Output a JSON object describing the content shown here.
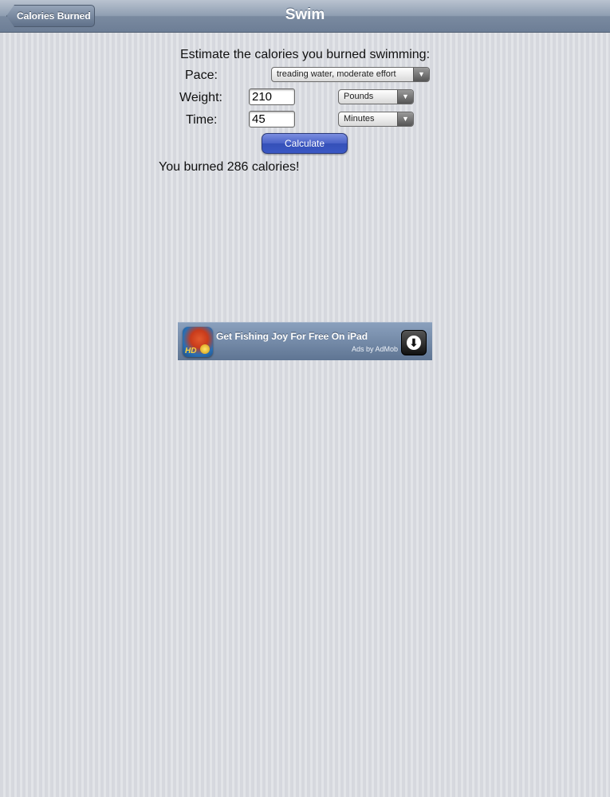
{
  "navbar": {
    "back_label": "Calories Burned",
    "title": "Swim"
  },
  "form": {
    "heading": "Estimate the calories you burned swimming:",
    "pace": {
      "label": "Pace:",
      "selected": "treading water, moderate effort",
      "arrow_icon": "▼"
    },
    "weight": {
      "label": "Weight:",
      "value": "210",
      "unit_selected": "Pounds",
      "arrow_icon": "▼"
    },
    "time": {
      "label": "Time:",
      "value": "45",
      "unit_selected": "Minutes",
      "arrow_icon": "▼"
    },
    "calculate_label": "Calculate"
  },
  "result": {
    "text": "You burned 286 calories!"
  },
  "ad": {
    "headline": "Get Fishing Joy For Free On iPad",
    "attribution": "Ads by AdMob",
    "icon_badge": "HD",
    "download_icon": "⬇"
  }
}
